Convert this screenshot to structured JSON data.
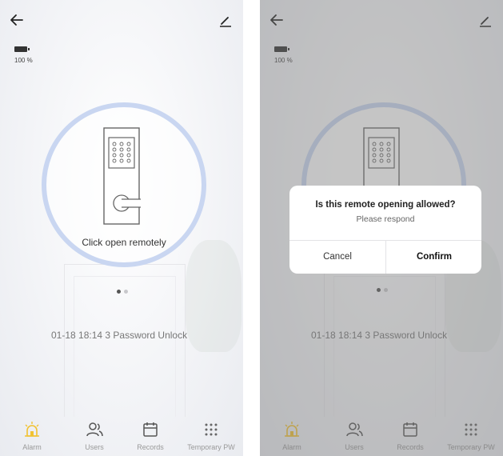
{
  "battery": {
    "label": "100 %"
  },
  "lock": {
    "action_label": "Click open remotely"
  },
  "pager": {
    "count": 2,
    "active": 1
  },
  "latest_record": {
    "text": "01-18 18:14  3 Password Unlock"
  },
  "tabs": [
    {
      "label": "Alarm",
      "icon": "alarm-icon",
      "active": true
    },
    {
      "label": "Users",
      "icon": "users-icon"
    },
    {
      "label": "Records",
      "icon": "calendar-icon"
    },
    {
      "label": "Temporary PW",
      "icon": "keypad-icon"
    }
  ],
  "dialog": {
    "title": "Is this remote opening allowed?",
    "message": "Please respond",
    "cancel_label": "Cancel",
    "confirm_label": "Confirm"
  },
  "colors": {
    "accent_yellow": "#f1c232",
    "ring": "#c9d6f1",
    "overlay": "#787878"
  }
}
